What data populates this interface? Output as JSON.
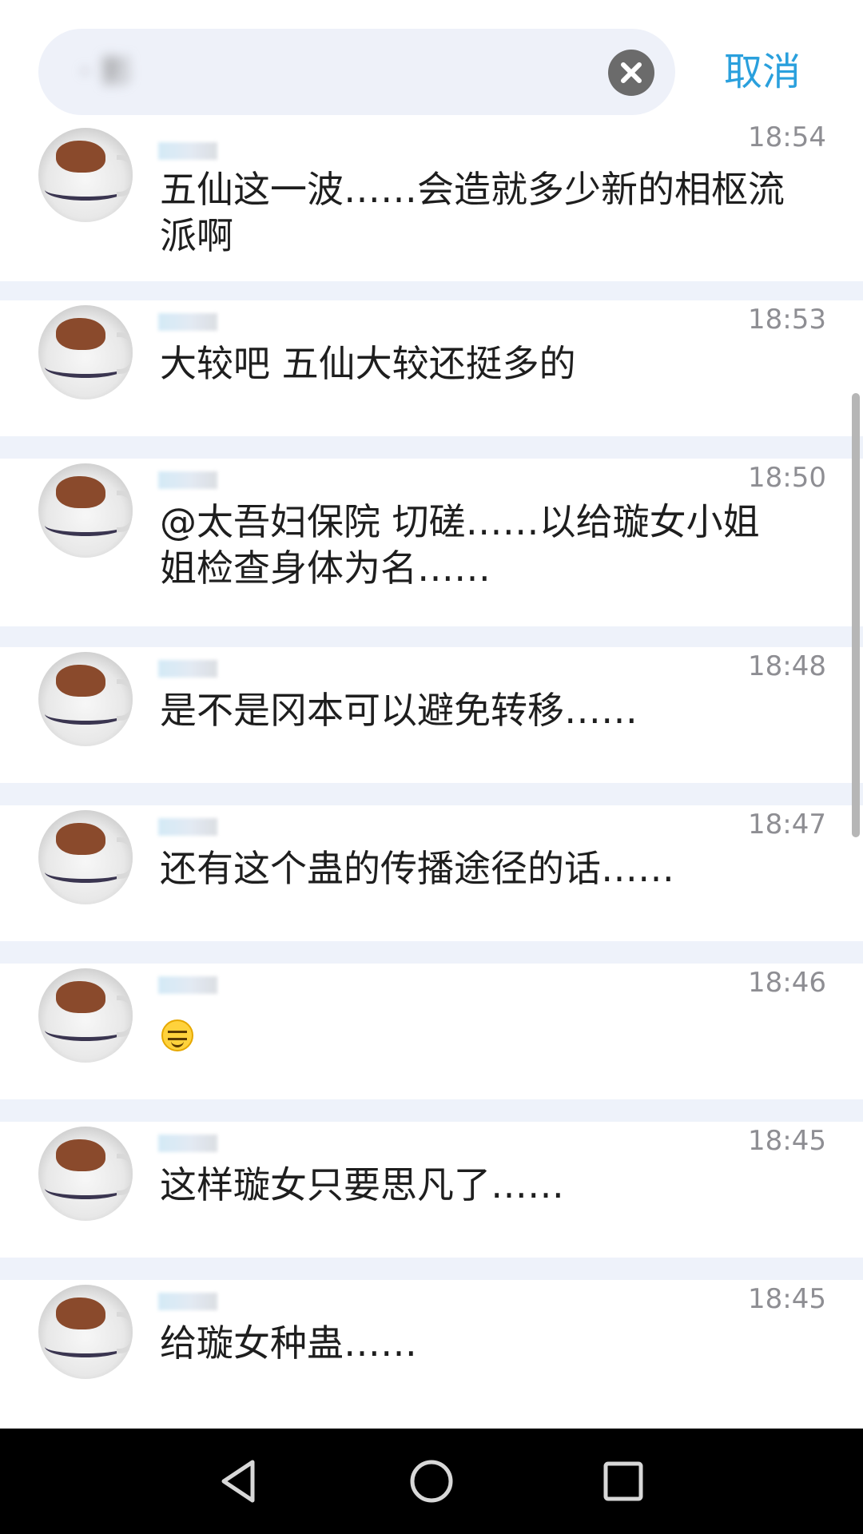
{
  "search": {
    "query": "· 影",
    "cancel_label": "取消"
  },
  "messages": [
    {
      "time": "18:54",
      "text": "五仙这一波……会造就多少新的相枢流\n派啊"
    },
    {
      "time": "18:53",
      "text": "大较吧 五仙大较还挺多的"
    },
    {
      "time": "18:50",
      "text": "@太吾妇保院 切磋……以给璇女小姐\n姐检查身体为名……"
    },
    {
      "time": "18:48",
      "text": "是不是冈本可以避免转移……"
    },
    {
      "time": "18:47",
      "text": "还有这个蛊的传播途径的话……"
    },
    {
      "time": "18:46",
      "text": "",
      "emoji": "smiling-face-emoji"
    },
    {
      "time": "18:45",
      "text": "这样璇女只要思凡了……"
    },
    {
      "time": "18:45",
      "text": "给璇女种蛊……"
    }
  ],
  "icons": {
    "clear": "close-circle-icon",
    "back": "back-triangle-icon",
    "home": "home-circle-icon",
    "recent": "recent-square-icon"
  },
  "colors": {
    "accent": "#2aa0dd",
    "separator": "#eef2fa",
    "navbar": "#000000"
  }
}
